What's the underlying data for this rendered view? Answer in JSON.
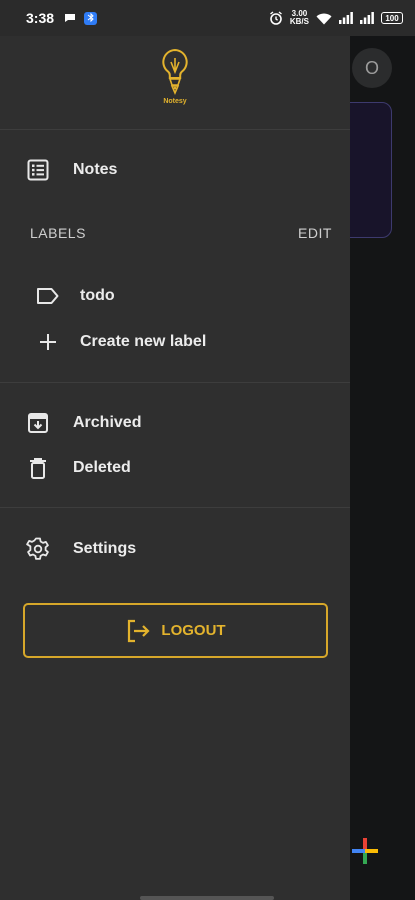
{
  "status_bar": {
    "time": "3:38",
    "net_speed_value": "3.00",
    "net_speed_unit": "KB/S",
    "battery": "100"
  },
  "drawer": {
    "logo_caption": "Notesy",
    "nav": {
      "notes": "Notes",
      "archived": "Archived",
      "deleted": "Deleted",
      "settings": "Settings"
    },
    "labels_section": {
      "heading": "LABELS",
      "edit": "EDIT",
      "items": [
        {
          "label": "todo",
          "icon": "label-tag-icon"
        }
      ],
      "create_new": "Create new label"
    },
    "logout": "LOGOUT"
  },
  "background": {
    "avatar_initial": "O"
  },
  "colors": {
    "drawer_bg": "#2f2f2f",
    "accent": "#e3b32d",
    "status_bar_bg": "#2b2b2b"
  }
}
